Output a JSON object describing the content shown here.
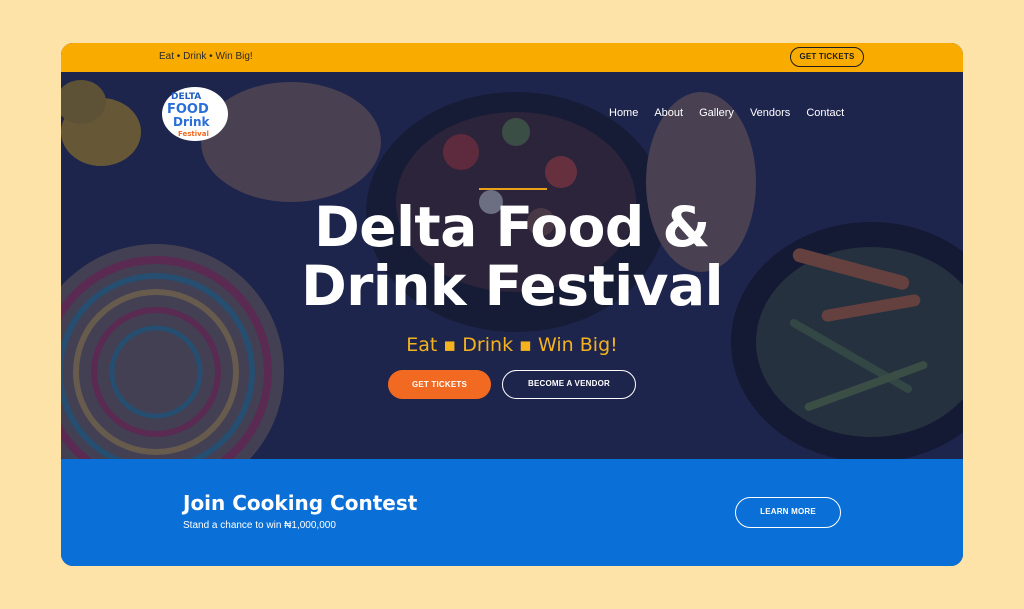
{
  "topbar": {
    "tagline": "Eat • Drink • Win Big!",
    "tickets_label": "GET TICKETS"
  },
  "logo": {
    "line1": "DELTA",
    "line2": "FOOD",
    "line3": "Drink",
    "line4": "Festival"
  },
  "nav": {
    "items": [
      "Home",
      "About",
      "Gallery",
      "Vendors",
      "Contact"
    ]
  },
  "hero": {
    "title_line1": "Delta Food &",
    "title_line2": "Drink Festival",
    "tagline": "Eat ▪ Drink ▪ Win Big!",
    "tickets_label": "GET TICKETS",
    "vendor_label": "BECOME A VENDOR"
  },
  "contest": {
    "title": "Join Cooking Contest",
    "subtitle": "Stand a chance to win ₦1,000,000",
    "learn_more_label": "LEARN MORE"
  },
  "colors": {
    "page_background": "#fde3a7",
    "topbar": "#f9ab00",
    "hero_overlay": "#1a2654",
    "accent_orange": "#f26a21",
    "tagline_gold": "#f4b21f",
    "contest_blue": "#0a6fd6"
  }
}
